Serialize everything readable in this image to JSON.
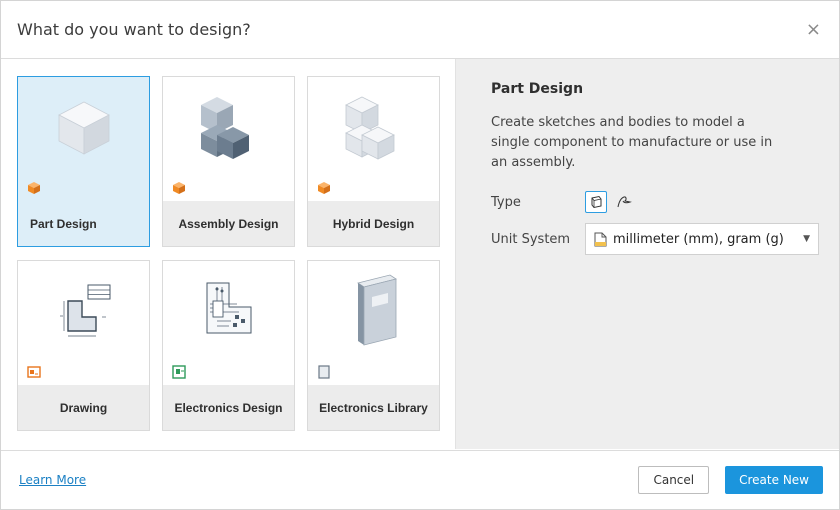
{
  "dialog": {
    "title": "What do you want to design?",
    "close_glyph": "×"
  },
  "designs": [
    {
      "label": "Part Design",
      "selected": true,
      "art": "cube-icon",
      "badge": "orange-cube-badge"
    },
    {
      "label": "Assembly Design",
      "selected": false,
      "art": "assembly-cubes-icon",
      "badge": "orange-cube-badge"
    },
    {
      "label": "Hybrid Design",
      "selected": false,
      "art": "hybrid-cubes-icon",
      "badge": "orange-cube-badge"
    },
    {
      "label": "Drawing",
      "selected": false,
      "art": "drawing-sheet-icon",
      "badge": "drawing-badge"
    },
    {
      "label": "Electronics Design",
      "selected": false,
      "art": "circuit-board-icon",
      "badge": "electronics-badge"
    },
    {
      "label": "Electronics Library",
      "selected": false,
      "art": "book-icon",
      "badge": "library-badge"
    }
  ],
  "details": {
    "title": "Part Design",
    "description": "Create sketches and bodies to model a single component to manufacture or use in an assembly.",
    "type_label": "Type",
    "unit_label": "Unit System",
    "unit_value": "millimeter (mm), gram (g)",
    "caret": "▼"
  },
  "footer": {
    "learn_more": "Learn More",
    "cancel": "Cancel",
    "create": "Create New"
  },
  "colors": {
    "accent": "#1b95dd",
    "selected_bg": "#ddeef8",
    "badge_orange": "#f08a24"
  }
}
